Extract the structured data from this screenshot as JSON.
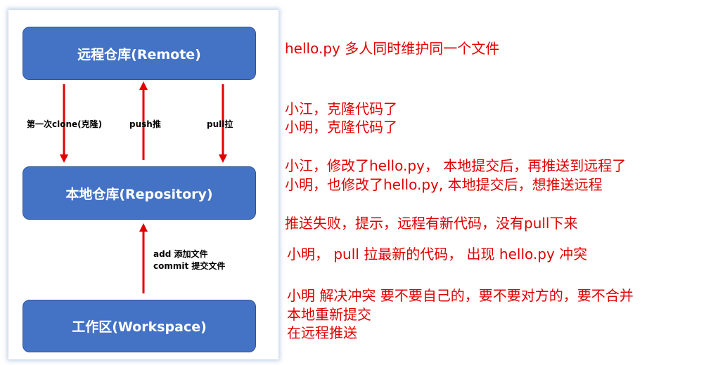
{
  "diagram": {
    "remote_label": "远程仓库(Remote)",
    "repository_label": "本地仓库(Repository)",
    "workspace_label": "工作区(Workspace)",
    "clone_label": "第一次clone(克隆)",
    "push_label": "push推",
    "pull_label": "pull拉",
    "add_label": "add 添加文件",
    "commit_label": "commit 提交文件",
    "box_color": "#4472c4",
    "arrow_color": "#e00000"
  },
  "notes": {
    "line1": "hello.py  多人同时维护同一个文件",
    "line2": "小江，克隆代码了",
    "line3": "小明，克隆代码了",
    "line4": "小江，修改了hello.py，  本地提交后，再推送到远程了",
    "line5": "小明，也修改了hello.py, 本地提交后，想推送远程",
    "line6": "推送失败，提示，远程有新代码，没有pull下来",
    "line7": "小明，  pull 拉最新的代码，     出现 hello.py 冲突",
    "line8": "小明  解决冲突     要不要自己的，要不要对方的，要不合并",
    "line9": "本地重新提交",
    "line10": "在远程推送",
    "text_color": "#e00000"
  }
}
